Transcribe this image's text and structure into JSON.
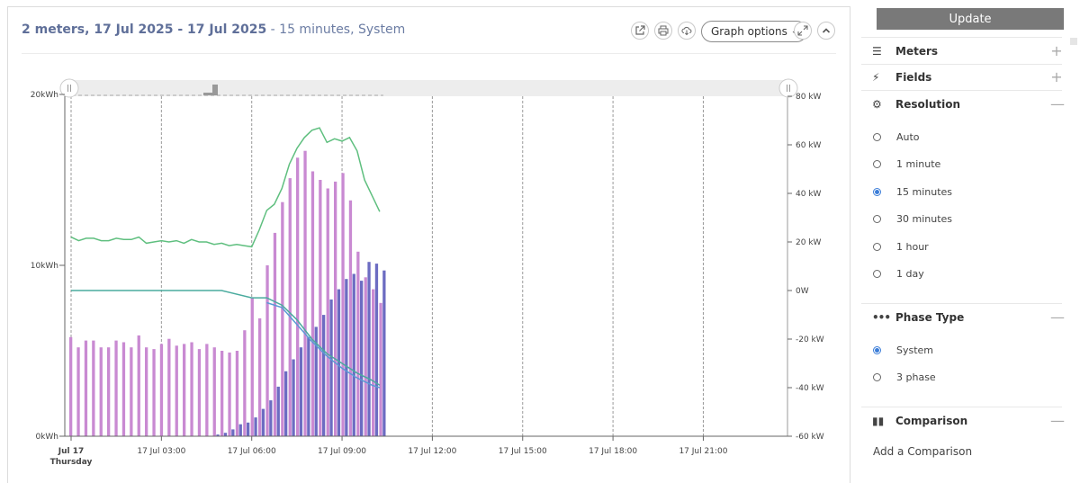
{
  "header": {
    "title_bold": "2 meters, 17 Jul 2025 - 17 Jul 2025",
    "title_rest": " - 15 minutes, System",
    "graph_options_label": "Graph options"
  },
  "toolbar_icons": [
    "external-link-icon",
    "print-icon",
    "cloud-download-icon",
    "expand-icon",
    "collapse-up-icon"
  ],
  "sidebar": {
    "update_label": "Update",
    "meters_label": "Meters",
    "fields_label": "Fields",
    "resolution_label": "Resolution",
    "resolution_options": [
      "Auto",
      "1 minute",
      "15 minutes",
      "30 minutes",
      "1 hour",
      "1 day"
    ],
    "resolution_selected": 2,
    "phase_type_label": "Phase Type",
    "phase_options": [
      "System",
      "3 phase"
    ],
    "phase_selected": 0,
    "comparison_label": "Comparison",
    "add_comparison_label": "Add a Comparison"
  },
  "colors": {
    "bar_pink": "#c98ad2",
    "bar_blue": "#6c6cc2",
    "line_green": "#5fbf7f",
    "line_teal": "#4aab9e",
    "line_blue": "#5a9bd5",
    "title": "#6b7ca3",
    "accent_radio": "#3b7dd8"
  },
  "chart_data": {
    "type": "bar",
    "x_ticks": [
      {
        "label": "Jul 17",
        "sub": "Thursday",
        "bold": true
      },
      {
        "label": "17 Jul 03:00"
      },
      {
        "label": "17 Jul 06:00"
      },
      {
        "label": "17 Jul 09:00"
      },
      {
        "label": "17 Jul 12:00"
      },
      {
        "label": "17 Jul 15:00"
      },
      {
        "label": "17 Jul 18:00"
      },
      {
        "label": "17 Jul 21:00"
      }
    ],
    "x_range_hours": [
      0,
      24
    ],
    "y_left": {
      "ticks": [
        0,
        10,
        20
      ],
      "tick_labels": [
        "0kWh",
        "10kWh",
        "20kWh"
      ],
      "ylim": [
        0,
        20
      ]
    },
    "y_right": {
      "ticks": [
        -60,
        -40,
        -20,
        0,
        20,
        40,
        60,
        80
      ],
      "tick_labels": [
        "-60 kW",
        "-40 kW",
        "-20 kW",
        "0W",
        "20 kW",
        "40 kW",
        "60 kW",
        "80 kW"
      ],
      "ylim": [
        -60,
        80
      ]
    },
    "bar_series": [
      {
        "axis": "left",
        "values": [
          5.8,
          5.2,
          5.6,
          5.6,
          5.2,
          5.2,
          5.6,
          5.5,
          5.2,
          5.9,
          5.2,
          5.1,
          5.4,
          5.7,
          5.3,
          5.4,
          5.5,
          5.1,
          5.4,
          5.2,
          5.0,
          4.9,
          5.0,
          6.2,
          8.1,
          6.9,
          10.0,
          11.9,
          13.7,
          15.1,
          16.3,
          16.7,
          15.5,
          15.0,
          14.5,
          14.9,
          15.4,
          13.8,
          10.8,
          9.3,
          8.6,
          7.8
        ]
      },
      {
        "axis": "left",
        "values": [
          0,
          0,
          0,
          0,
          0,
          0,
          0,
          0,
          0,
          0,
          0,
          0,
          0,
          0,
          0,
          0,
          0,
          0,
          0,
          0.1,
          0.2,
          0.4,
          0.7,
          0.8,
          1.1,
          1.6,
          2.1,
          2.9,
          3.8,
          4.5,
          5.2,
          5.8,
          6.4,
          7.1,
          8.0,
          8.6,
          9.2,
          9.5,
          9.1,
          10.2,
          10.1,
          9.7
        ]
      }
    ],
    "line_series": [
      {
        "axis": "right",
        "color_key": "line_green",
        "x_hours": [
          0,
          0.25,
          0.5,
          0.75,
          1,
          1.25,
          1.5,
          1.75,
          2,
          2.25,
          2.5,
          2.75,
          3,
          3.25,
          3.5,
          3.75,
          4,
          4.25,
          4.5,
          4.75,
          5,
          5.25,
          5.5,
          5.75,
          6,
          6.25,
          6.5,
          6.75,
          7,
          7.25,
          7.5,
          7.75,
          8,
          8.25,
          8.5,
          8.75,
          9,
          9.25,
          9.5,
          9.75,
          10,
          10.25
        ],
        "values": [
          22,
          20.5,
          21.5,
          21.5,
          20.5,
          20.5,
          21.5,
          21,
          21,
          22,
          19.5,
          20,
          20.5,
          20,
          20.5,
          19.5,
          21,
          20,
          20,
          19,
          19.5,
          18.5,
          19,
          18.5,
          18,
          25,
          33,
          35.5,
          42,
          52,
          58.5,
          63,
          66,
          67,
          61,
          62.5,
          61.5,
          63,
          57.5,
          45.5,
          39,
          32.5,
          31
        ]
      },
      {
        "axis": "right",
        "color_key": "line_teal",
        "x_hours": [
          0,
          1,
          2,
          3,
          4,
          5,
          6,
          6.5,
          7,
          7.5,
          8,
          8.5,
          9,
          9.5,
          10,
          10.25
        ],
        "values": [
          0,
          0,
          0,
          0,
          0,
          0,
          -3,
          -3,
          -6,
          -12,
          -20,
          -26,
          -30,
          -34,
          -37,
          -39
        ]
      },
      {
        "axis": "right",
        "color_key": "line_blue",
        "x_hours": [
          6.5,
          7,
          7.5,
          8,
          8.5,
          9,
          9.5,
          10,
          10.25
        ],
        "values": [
          -5,
          -7,
          -14,
          -21,
          -27,
          -32,
          -36,
          -39,
          -40
        ]
      }
    ],
    "legend": "none",
    "grid": "vertical dashed"
  }
}
